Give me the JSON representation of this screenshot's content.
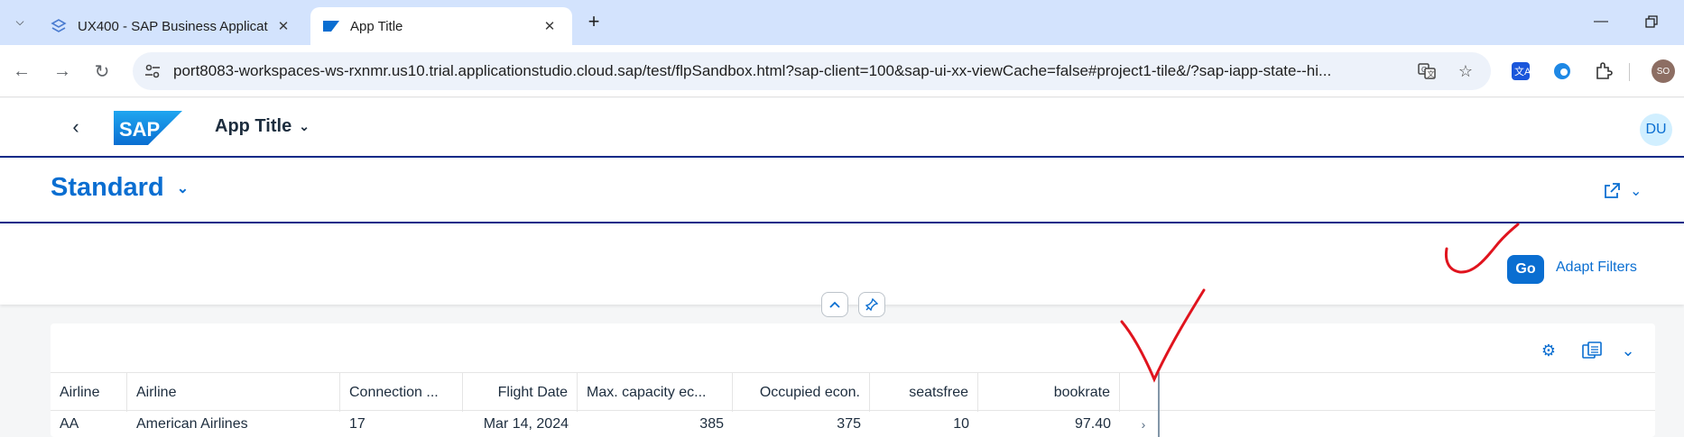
{
  "browser": {
    "tabs": [
      {
        "title": "UX400 - SAP Business Applicat",
        "active": false
      },
      {
        "title": "App Title",
        "active": true
      }
    ],
    "url": "port8083-workspaces-ws-rxnmr.us10.trial.applicationstudio.cloud.sap/test/flpSandbox.html?sap-client=100&sap-ui-xx-viewCache=false#project1-tile&/?sap-iapp-state--hi...",
    "profile_initials": "SO"
  },
  "shell": {
    "logo_text": "SAP",
    "app_title": "App Title",
    "avatar_initials": "DU"
  },
  "page": {
    "variant": "Standard"
  },
  "filterbar": {
    "go_label": "Go",
    "adapt_label": "Adapt Filters"
  },
  "table": {
    "columns": [
      "Airline",
      "Airline",
      "Connection ...",
      "Flight Date",
      "Max. capacity ec...",
      "Occupied econ.",
      "seatsfree",
      "bookrate"
    ],
    "rows": [
      [
        "AA",
        "American Airlines",
        "17",
        "Mar 14, 2024",
        "385",
        "375",
        "10",
        "97.40"
      ]
    ]
  },
  "colors": {
    "brand_blue": "#0a6ed1",
    "shell_border": "#0a2a88",
    "annotation_red": "#e0141e"
  }
}
